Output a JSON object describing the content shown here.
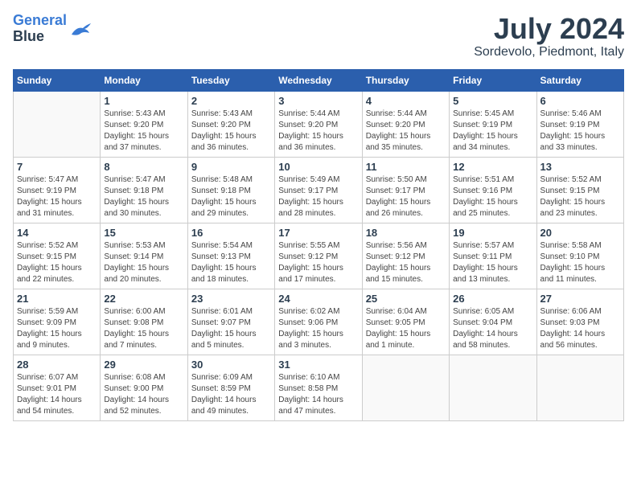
{
  "header": {
    "logo_line1": "General",
    "logo_line2": "Blue",
    "month_year": "July 2024",
    "location": "Sordevolo, Piedmont, Italy"
  },
  "weekdays": [
    "Sunday",
    "Monday",
    "Tuesday",
    "Wednesday",
    "Thursday",
    "Friday",
    "Saturday"
  ],
  "weeks": [
    [
      {
        "day": "",
        "sunrise": "",
        "sunset": "",
        "daylight": ""
      },
      {
        "day": "1",
        "sunrise": "5:43 AM",
        "sunset": "9:20 PM",
        "daylight": "15 hours and 37 minutes."
      },
      {
        "day": "2",
        "sunrise": "5:43 AM",
        "sunset": "9:20 PM",
        "daylight": "15 hours and 36 minutes."
      },
      {
        "day": "3",
        "sunrise": "5:44 AM",
        "sunset": "9:20 PM",
        "daylight": "15 hours and 36 minutes."
      },
      {
        "day": "4",
        "sunrise": "5:44 AM",
        "sunset": "9:20 PM",
        "daylight": "15 hours and 35 minutes."
      },
      {
        "day": "5",
        "sunrise": "5:45 AM",
        "sunset": "9:19 PM",
        "daylight": "15 hours and 34 minutes."
      },
      {
        "day": "6",
        "sunrise": "5:46 AM",
        "sunset": "9:19 PM",
        "daylight": "15 hours and 33 minutes."
      }
    ],
    [
      {
        "day": "7",
        "sunrise": "5:47 AM",
        "sunset": "9:19 PM",
        "daylight": "15 hours and 31 minutes."
      },
      {
        "day": "8",
        "sunrise": "5:47 AM",
        "sunset": "9:18 PM",
        "daylight": "15 hours and 30 minutes."
      },
      {
        "day": "9",
        "sunrise": "5:48 AM",
        "sunset": "9:18 PM",
        "daylight": "15 hours and 29 minutes."
      },
      {
        "day": "10",
        "sunrise": "5:49 AM",
        "sunset": "9:17 PM",
        "daylight": "15 hours and 28 minutes."
      },
      {
        "day": "11",
        "sunrise": "5:50 AM",
        "sunset": "9:17 PM",
        "daylight": "15 hours and 26 minutes."
      },
      {
        "day": "12",
        "sunrise": "5:51 AM",
        "sunset": "9:16 PM",
        "daylight": "15 hours and 25 minutes."
      },
      {
        "day": "13",
        "sunrise": "5:52 AM",
        "sunset": "9:15 PM",
        "daylight": "15 hours and 23 minutes."
      }
    ],
    [
      {
        "day": "14",
        "sunrise": "5:52 AM",
        "sunset": "9:15 PM",
        "daylight": "15 hours and 22 minutes."
      },
      {
        "day": "15",
        "sunrise": "5:53 AM",
        "sunset": "9:14 PM",
        "daylight": "15 hours and 20 minutes."
      },
      {
        "day": "16",
        "sunrise": "5:54 AM",
        "sunset": "9:13 PM",
        "daylight": "15 hours and 18 minutes."
      },
      {
        "day": "17",
        "sunrise": "5:55 AM",
        "sunset": "9:12 PM",
        "daylight": "15 hours and 17 minutes."
      },
      {
        "day": "18",
        "sunrise": "5:56 AM",
        "sunset": "9:12 PM",
        "daylight": "15 hours and 15 minutes."
      },
      {
        "day": "19",
        "sunrise": "5:57 AM",
        "sunset": "9:11 PM",
        "daylight": "15 hours and 13 minutes."
      },
      {
        "day": "20",
        "sunrise": "5:58 AM",
        "sunset": "9:10 PM",
        "daylight": "15 hours and 11 minutes."
      }
    ],
    [
      {
        "day": "21",
        "sunrise": "5:59 AM",
        "sunset": "9:09 PM",
        "daylight": "15 hours and 9 minutes."
      },
      {
        "day": "22",
        "sunrise": "6:00 AM",
        "sunset": "9:08 PM",
        "daylight": "15 hours and 7 minutes."
      },
      {
        "day": "23",
        "sunrise": "6:01 AM",
        "sunset": "9:07 PM",
        "daylight": "15 hours and 5 minutes."
      },
      {
        "day": "24",
        "sunrise": "6:02 AM",
        "sunset": "9:06 PM",
        "daylight": "15 hours and 3 minutes."
      },
      {
        "day": "25",
        "sunrise": "6:04 AM",
        "sunset": "9:05 PM",
        "daylight": "15 hours and 1 minute."
      },
      {
        "day": "26",
        "sunrise": "6:05 AM",
        "sunset": "9:04 PM",
        "daylight": "14 hours and 58 minutes."
      },
      {
        "day": "27",
        "sunrise": "6:06 AM",
        "sunset": "9:03 PM",
        "daylight": "14 hours and 56 minutes."
      }
    ],
    [
      {
        "day": "28",
        "sunrise": "6:07 AM",
        "sunset": "9:01 PM",
        "daylight": "14 hours and 54 minutes."
      },
      {
        "day": "29",
        "sunrise": "6:08 AM",
        "sunset": "9:00 PM",
        "daylight": "14 hours and 52 minutes."
      },
      {
        "day": "30",
        "sunrise": "6:09 AM",
        "sunset": "8:59 PM",
        "daylight": "14 hours and 49 minutes."
      },
      {
        "day": "31",
        "sunrise": "6:10 AM",
        "sunset": "8:58 PM",
        "daylight": "14 hours and 47 minutes."
      },
      {
        "day": "",
        "sunrise": "",
        "sunset": "",
        "daylight": ""
      },
      {
        "day": "",
        "sunrise": "",
        "sunset": "",
        "daylight": ""
      },
      {
        "day": "",
        "sunrise": "",
        "sunset": "",
        "daylight": ""
      }
    ]
  ],
  "labels": {
    "sunrise_prefix": "Sunrise: ",
    "sunset_prefix": "Sunset: ",
    "daylight_prefix": "Daylight: "
  }
}
